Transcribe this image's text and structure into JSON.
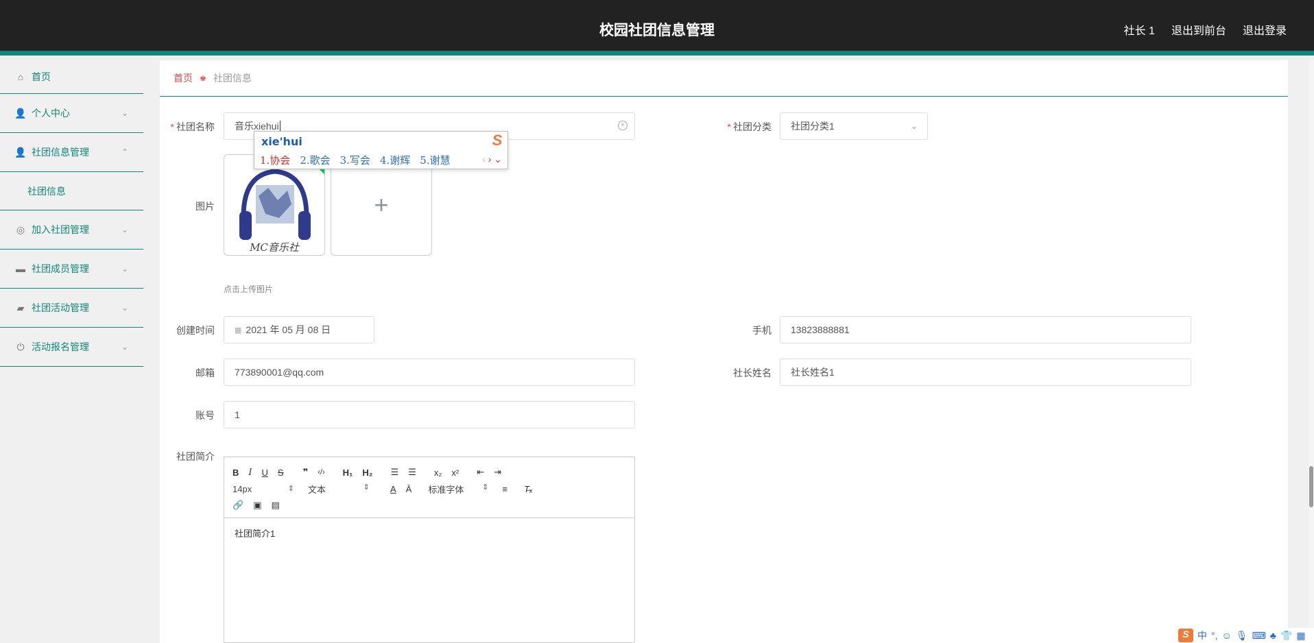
{
  "header": {
    "title": "校园社团信息管理",
    "user": "社长 1",
    "to_front": "退出到前台",
    "logout": "退出登录"
  },
  "sidebar": {
    "items": [
      {
        "label": "首页",
        "icon": "home-icon"
      },
      {
        "label": "个人中心",
        "icon": "user-icon"
      },
      {
        "label": "社团信息管理",
        "icon": "user-icon",
        "expanded": true
      },
      {
        "label": "社团信息",
        "sub": true
      },
      {
        "label": "加入社团管理",
        "icon": "lifebuoy-icon"
      },
      {
        "label": "社团成员管理",
        "icon": "briefcase-icon"
      },
      {
        "label": "社团活动管理",
        "icon": "car-icon"
      },
      {
        "label": "活动报名管理",
        "icon": "power-icon"
      }
    ]
  },
  "breadcrumb": {
    "home": "首页",
    "current": "社团信息"
  },
  "form": {
    "name_label": "社团名称",
    "name_value": "音乐xiehui",
    "category_label": "社团分类",
    "category_value": "社团分类1",
    "image_label": "图片",
    "image_text": "MC音乐社",
    "upload_hint": "点击上传图片",
    "created_label": "创建时间",
    "created_value": "2021 年 05 月 08 日",
    "phone_label": "手机",
    "phone_value": "13823888881",
    "email_label": "邮箱",
    "email_value": "773890001@qq.com",
    "leader_label": "社长姓名",
    "leader_value": "社长姓名1",
    "account_label": "账号",
    "account_value": "1",
    "intro_label": "社团简介",
    "intro_value": "社团简介1"
  },
  "ime": {
    "composition": "xie'hui",
    "candidates": [
      "1.协会",
      "2.歌会",
      "3.写会",
      "4.谢辉",
      "5.谢慧"
    ]
  },
  "editor": {
    "font_size": "14px",
    "block_type": "文本",
    "font_family": "标准字体"
  },
  "imebar": {
    "mode": "中"
  }
}
